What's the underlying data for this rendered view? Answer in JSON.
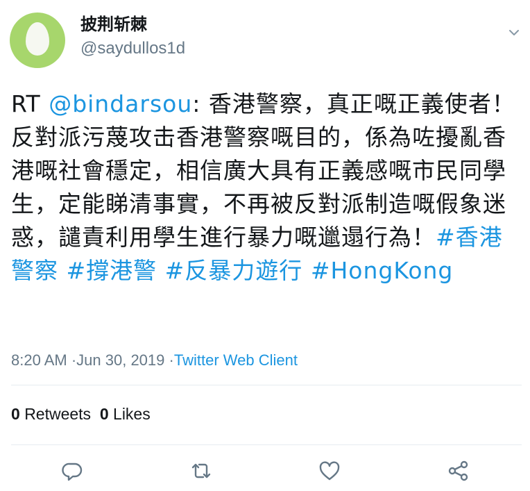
{
  "user": {
    "display_name": "披荆斩棘",
    "handle": "@saydullos1d",
    "avatar": "default-egg-avatar"
  },
  "tweet": {
    "prefix": "RT ",
    "mention": "@bindarsou",
    "body": ": 香港警察，真正嘅正義使者！ 反對派污蔑攻击香港警察嘅目的，係為咗擾亂香港嘅社會穩定，相信廣大具有正義感嘅市民同學生，定能睇清事實，不再被反對派制造嘅假象迷惑，譴責利用學生進行暴力嘅邋遢行為！",
    "hashtags": [
      "#香港警察",
      "#撐港警",
      "#反暴力遊行",
      "#HongKong"
    ]
  },
  "meta": {
    "time": "8:20 AM",
    "date": "Jun 30, 2019",
    "separator": "·",
    "source": "Twitter Web Client"
  },
  "stats": {
    "retweets_count": "0",
    "retweets_label": "Retweets",
    "likes_count": "0",
    "likes_label": "Likes"
  },
  "icons": {
    "reply": "reply-icon",
    "retweet": "retweet-icon",
    "like": "heart-icon",
    "share": "share-icon",
    "menu": "chevron-down-icon"
  },
  "colors": {
    "link": "#1b95e0",
    "secondary_text": "#657786",
    "primary_text": "#14171a",
    "divider": "#e6ecf0",
    "avatar_bg": "#a7d66c"
  }
}
